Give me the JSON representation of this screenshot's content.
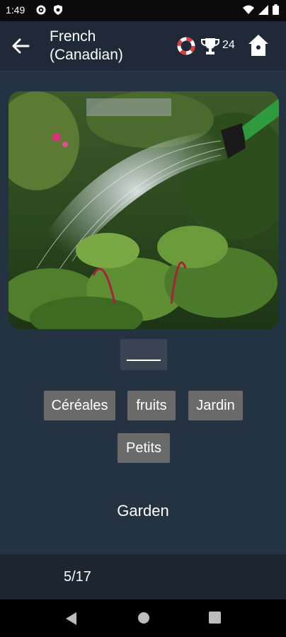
{
  "status_bar": {
    "time": "1:49",
    "icons": [
      "gear-icon",
      "shield-icon",
      "wifi-icon",
      "signal-icon",
      "battery-icon"
    ]
  },
  "app_bar": {
    "title": "French (Canadian)",
    "score": "24",
    "icons": [
      "back-arrow-icon",
      "lifebuoy-icon",
      "trophy-icon",
      "home-icon"
    ]
  },
  "quiz": {
    "image_subject": "watering can spraying water over a vegetable garden",
    "blank": "____",
    "choices": [
      "Céréales",
      "fruits",
      "Jardin",
      "Petits"
    ],
    "prompt_word": "Garden"
  },
  "footer": {
    "progress": "5/17"
  },
  "colors": {
    "background": "#253241",
    "app_bar": "#1f2937",
    "choice_bg": "#6a6a6a",
    "footer_bg": "#1c2530"
  }
}
